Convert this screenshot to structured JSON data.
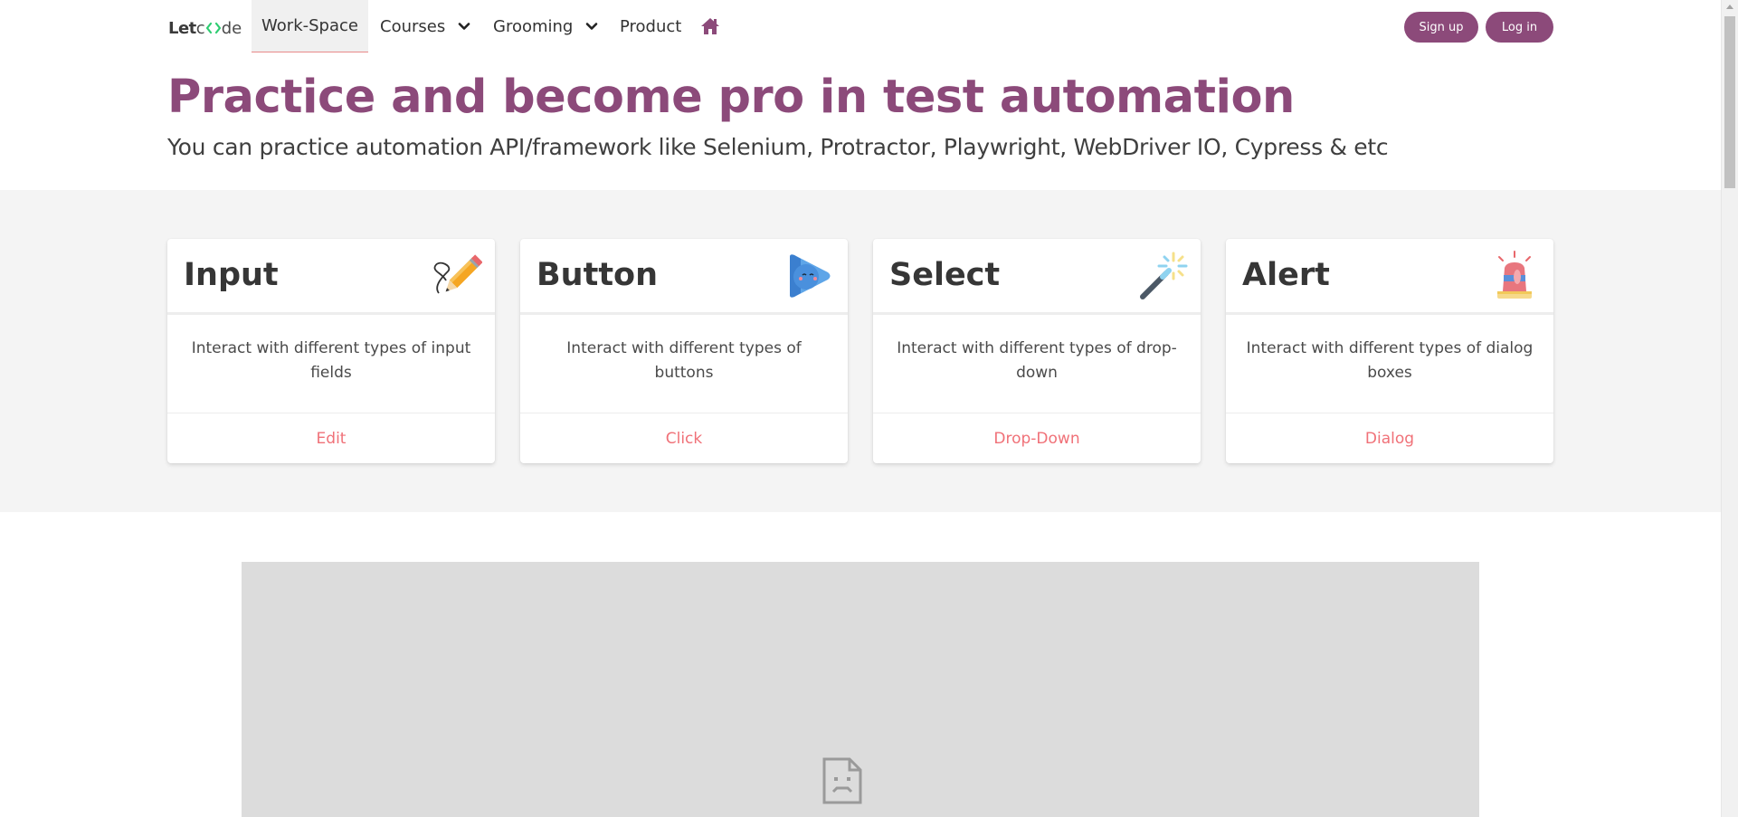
{
  "brand": {
    "part1": "Let",
    "part2": "de"
  },
  "nav": {
    "items": [
      {
        "label": "Work-Space",
        "active": true,
        "dropdown": false
      },
      {
        "label": "Courses",
        "active": false,
        "dropdown": true
      },
      {
        "label": "Grooming",
        "active": false,
        "dropdown": true
      },
      {
        "label": "Product",
        "active": false,
        "dropdown": false
      }
    ],
    "home_icon": "home-icon",
    "signup_label": "Sign up",
    "login_label": "Log in"
  },
  "hero": {
    "title": "Practice and become pro in test automation",
    "subtitle": "You can practice automation API/framework like Selenium, Protractor, Playwright, WebDriver IO, Cypress & etc"
  },
  "cards": [
    {
      "title": "Input",
      "icon": "pencil-icon",
      "description": "Interact with different types of input fields",
      "link": "Edit"
    },
    {
      "title": "Button",
      "icon": "play-button-icon",
      "description": "Interact with different types of buttons",
      "link": "Click"
    },
    {
      "title": "Select",
      "icon": "magic-wand-icon",
      "description": "Interact with different types of drop-down",
      "link": "Drop-Down"
    },
    {
      "title": "Alert",
      "icon": "siren-icon",
      "description": "Interact with different types of dialog boxes",
      "link": "Dialog"
    }
  ],
  "video": {
    "icon": "broken-page-icon"
  },
  "colors": {
    "brand_purple": "#8c4a7a",
    "link_pink": "#f07178",
    "band_bg": "#f4f4f4"
  }
}
